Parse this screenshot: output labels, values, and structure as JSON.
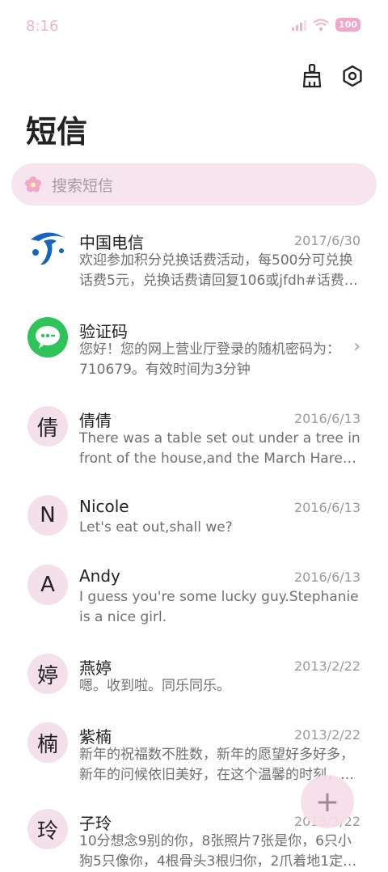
{
  "status": {
    "time": "8:16",
    "battery": "100"
  },
  "header": {
    "title": "短信"
  },
  "search": {
    "placeholder": "搜索短信"
  },
  "messages": [
    {
      "name": "中国电信",
      "date": "2017/6/30",
      "preview": "欢迎参加积分兑换话费活动，每500分可兑换话费5元，兑换话费请回复106或jfdh#话费…",
      "avatar": ""
    },
    {
      "name": "验证码",
      "date": "",
      "preview": "您好！您的网上营业厅登录的随机密码为：710679。有效时间为3分钟",
      "avatar": ""
    },
    {
      "name": "倩倩",
      "date": "2016/6/13",
      "preview": "There was a table set out under a tree in front of the house,and the March Hare an…",
      "avatar": "倩"
    },
    {
      "name": "Nicole",
      "date": "2016/6/13",
      "preview": "Let's eat out,shall we?",
      "avatar": "N"
    },
    {
      "name": "Andy",
      "date": "2016/6/13",
      "preview": "I guess you're some lucky guy.Stephanie is a nice girl.",
      "avatar": "A"
    },
    {
      "name": "燕婷",
      "date": "2013/2/22",
      "preview": "嗯。收到啦。同乐同乐。",
      "avatar": "婷"
    },
    {
      "name": "紫楠",
      "date": "2013/2/22",
      "preview": "新年的祝福数不胜数，新年的愿望好多好多，新年的问候依旧美好，在这个温馨的时刻，…",
      "avatar": "楠"
    },
    {
      "name": "子玲",
      "date": "2013/2/22",
      "preview": "10分想念9别的你，8张照片7张是你，6只小狗5只像你，4根骨头3根归你，2爪着地1定…",
      "avatar": "玲"
    }
  ],
  "fab": {
    "label": "+"
  },
  "colors": {
    "accent": "#f3a6c8",
    "search_bg": "#f6e4ee",
    "telecom_blue": "#1565c0",
    "code_green": "#2ec45a"
  }
}
